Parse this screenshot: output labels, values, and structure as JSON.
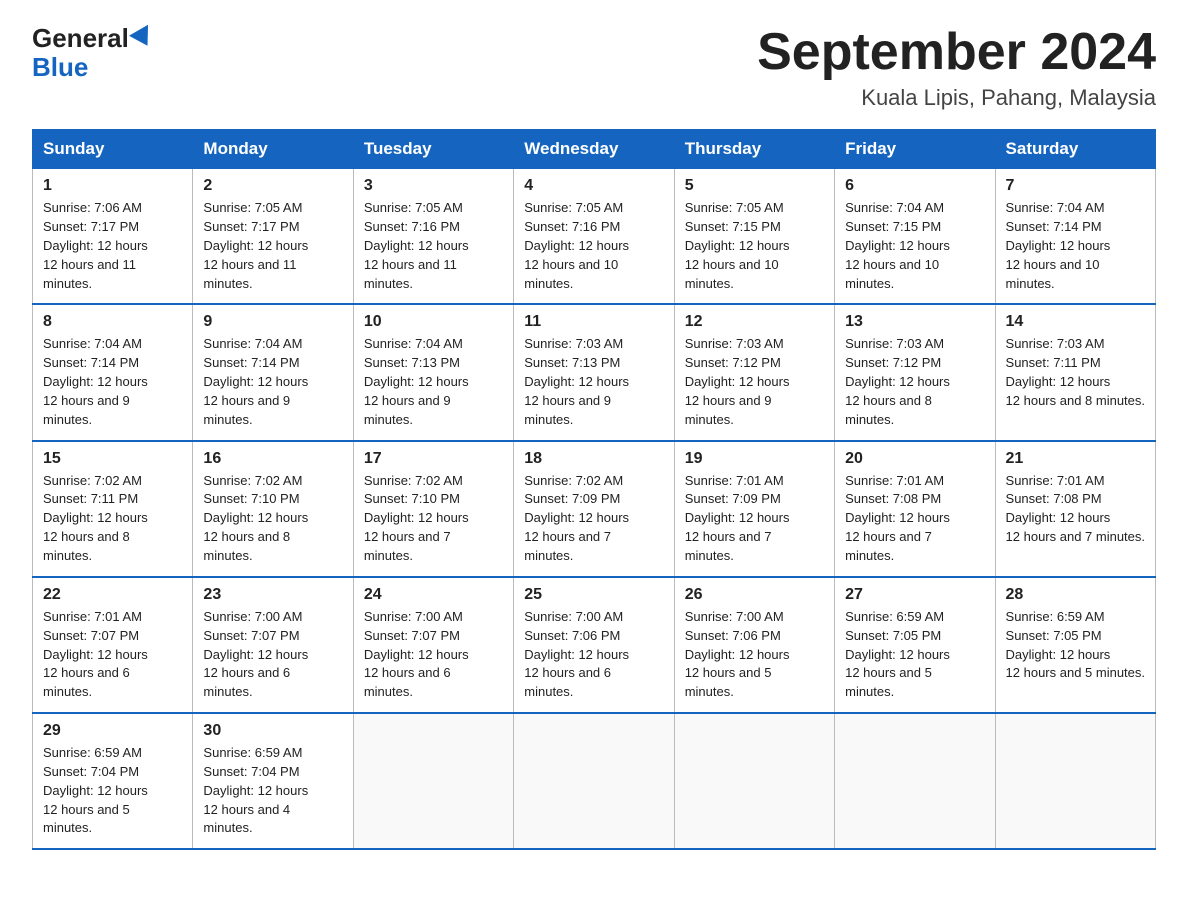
{
  "header": {
    "logo_general": "General",
    "logo_blue": "Blue",
    "title": "September 2024",
    "location": "Kuala Lipis, Pahang, Malaysia"
  },
  "days_of_week": [
    "Sunday",
    "Monday",
    "Tuesday",
    "Wednesday",
    "Thursday",
    "Friday",
    "Saturday"
  ],
  "weeks": [
    [
      {
        "day": "1",
        "sunrise": "7:06 AM",
        "sunset": "7:17 PM",
        "daylight": "12 hours and 11 minutes."
      },
      {
        "day": "2",
        "sunrise": "7:05 AM",
        "sunset": "7:17 PM",
        "daylight": "12 hours and 11 minutes."
      },
      {
        "day": "3",
        "sunrise": "7:05 AM",
        "sunset": "7:16 PM",
        "daylight": "12 hours and 11 minutes."
      },
      {
        "day": "4",
        "sunrise": "7:05 AM",
        "sunset": "7:16 PM",
        "daylight": "12 hours and 10 minutes."
      },
      {
        "day": "5",
        "sunrise": "7:05 AM",
        "sunset": "7:15 PM",
        "daylight": "12 hours and 10 minutes."
      },
      {
        "day": "6",
        "sunrise": "7:04 AM",
        "sunset": "7:15 PM",
        "daylight": "12 hours and 10 minutes."
      },
      {
        "day": "7",
        "sunrise": "7:04 AM",
        "sunset": "7:14 PM",
        "daylight": "12 hours and 10 minutes."
      }
    ],
    [
      {
        "day": "8",
        "sunrise": "7:04 AM",
        "sunset": "7:14 PM",
        "daylight": "12 hours and 9 minutes."
      },
      {
        "day": "9",
        "sunrise": "7:04 AM",
        "sunset": "7:14 PM",
        "daylight": "12 hours and 9 minutes."
      },
      {
        "day": "10",
        "sunrise": "7:04 AM",
        "sunset": "7:13 PM",
        "daylight": "12 hours and 9 minutes."
      },
      {
        "day": "11",
        "sunrise": "7:03 AM",
        "sunset": "7:13 PM",
        "daylight": "12 hours and 9 minutes."
      },
      {
        "day": "12",
        "sunrise": "7:03 AM",
        "sunset": "7:12 PM",
        "daylight": "12 hours and 9 minutes."
      },
      {
        "day": "13",
        "sunrise": "7:03 AM",
        "sunset": "7:12 PM",
        "daylight": "12 hours and 8 minutes."
      },
      {
        "day": "14",
        "sunrise": "7:03 AM",
        "sunset": "7:11 PM",
        "daylight": "12 hours and 8 minutes."
      }
    ],
    [
      {
        "day": "15",
        "sunrise": "7:02 AM",
        "sunset": "7:11 PM",
        "daylight": "12 hours and 8 minutes."
      },
      {
        "day": "16",
        "sunrise": "7:02 AM",
        "sunset": "7:10 PM",
        "daylight": "12 hours and 8 minutes."
      },
      {
        "day": "17",
        "sunrise": "7:02 AM",
        "sunset": "7:10 PM",
        "daylight": "12 hours and 7 minutes."
      },
      {
        "day": "18",
        "sunrise": "7:02 AM",
        "sunset": "7:09 PM",
        "daylight": "12 hours and 7 minutes."
      },
      {
        "day": "19",
        "sunrise": "7:01 AM",
        "sunset": "7:09 PM",
        "daylight": "12 hours and 7 minutes."
      },
      {
        "day": "20",
        "sunrise": "7:01 AM",
        "sunset": "7:08 PM",
        "daylight": "12 hours and 7 minutes."
      },
      {
        "day": "21",
        "sunrise": "7:01 AM",
        "sunset": "7:08 PM",
        "daylight": "12 hours and 7 minutes."
      }
    ],
    [
      {
        "day": "22",
        "sunrise": "7:01 AM",
        "sunset": "7:07 PM",
        "daylight": "12 hours and 6 minutes."
      },
      {
        "day": "23",
        "sunrise": "7:00 AM",
        "sunset": "7:07 PM",
        "daylight": "12 hours and 6 minutes."
      },
      {
        "day": "24",
        "sunrise": "7:00 AM",
        "sunset": "7:07 PM",
        "daylight": "12 hours and 6 minutes."
      },
      {
        "day": "25",
        "sunrise": "7:00 AM",
        "sunset": "7:06 PM",
        "daylight": "12 hours and 6 minutes."
      },
      {
        "day": "26",
        "sunrise": "7:00 AM",
        "sunset": "7:06 PM",
        "daylight": "12 hours and 5 minutes."
      },
      {
        "day": "27",
        "sunrise": "6:59 AM",
        "sunset": "7:05 PM",
        "daylight": "12 hours and 5 minutes."
      },
      {
        "day": "28",
        "sunrise": "6:59 AM",
        "sunset": "7:05 PM",
        "daylight": "12 hours and 5 minutes."
      }
    ],
    [
      {
        "day": "29",
        "sunrise": "6:59 AM",
        "sunset": "7:04 PM",
        "daylight": "12 hours and 5 minutes."
      },
      {
        "day": "30",
        "sunrise": "6:59 AM",
        "sunset": "7:04 PM",
        "daylight": "12 hours and 4 minutes."
      },
      null,
      null,
      null,
      null,
      null
    ]
  ]
}
